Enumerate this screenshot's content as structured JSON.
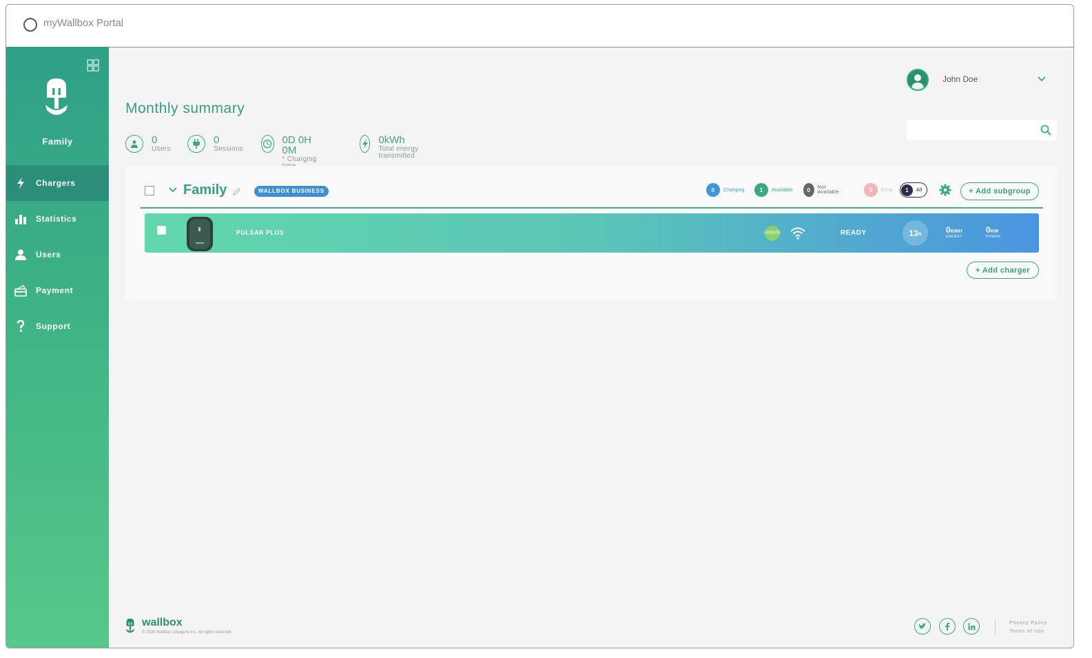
{
  "window": {
    "title": "myWallbox Portal"
  },
  "sidebar": {
    "group_name": "Family",
    "items": [
      {
        "label": "Chargers",
        "icon": "lightning-icon",
        "active": true
      },
      {
        "label": "Statistics",
        "icon": "bar-chart-icon"
      },
      {
        "label": "Users",
        "icon": "user-icon"
      },
      {
        "label": "Payment",
        "icon": "payment-icon"
      },
      {
        "label": "Support",
        "icon": "question-icon"
      }
    ]
  },
  "header": {
    "user_name": "John Doe",
    "search_placeholder": ""
  },
  "main": {
    "title": "Monthly summary",
    "stats": [
      {
        "value": "0",
        "label": "Users",
        "icon": "user-icon"
      },
      {
        "value": "0",
        "label": "Sessions",
        "icon": "plug-icon"
      },
      {
        "value": "0D 0H 0M",
        "label": "* Charging time",
        "icon": "clock-icon"
      },
      {
        "value": "0kWh",
        "label": "Total energy transmitted",
        "icon": "lightning-icon"
      }
    ]
  },
  "group": {
    "name": "Family",
    "badge": "WALLBOX BUSINESS",
    "filters": [
      {
        "count": "0",
        "label": "Charging",
        "color": "#3f96dc"
      },
      {
        "count": "1",
        "label": "Available",
        "color": "#3aa981"
      },
      {
        "count": "0",
        "label": "Not Available",
        "color": "#666666"
      },
      {
        "count": "0",
        "label": "Error",
        "color": "#f2b6b6"
      },
      {
        "count": "1",
        "label": "All",
        "color": "#2b2b4a"
      }
    ],
    "add_subgroup": "+ Add subgroup",
    "add_charger": "+ Add charger"
  },
  "charger": {
    "name": "PULSAR PLUS",
    "status": "READY",
    "current": "13",
    "current_unit": "A",
    "energy_value": "0",
    "energy_unit": "KWH",
    "energy_label": "ENERGY",
    "power_value": "0",
    "power_unit": "KW",
    "power_label": "POWER",
    "pill_text": "UPDATE"
  },
  "footer": {
    "brand": "wallbox",
    "copyright": "© 2020 Wallbox Chargers Inc. All rights reserved",
    "links": [
      "Privacy Policy",
      "Terms of Use"
    ],
    "social": [
      "twitter-icon",
      "facebook-icon",
      "linkedin-icon"
    ]
  },
  "colors": {
    "accent": "#3aa981",
    "sidebar_active": "#2a8e78",
    "charger_start": "#62d7ac",
    "charger_end": "#4a95e0"
  }
}
